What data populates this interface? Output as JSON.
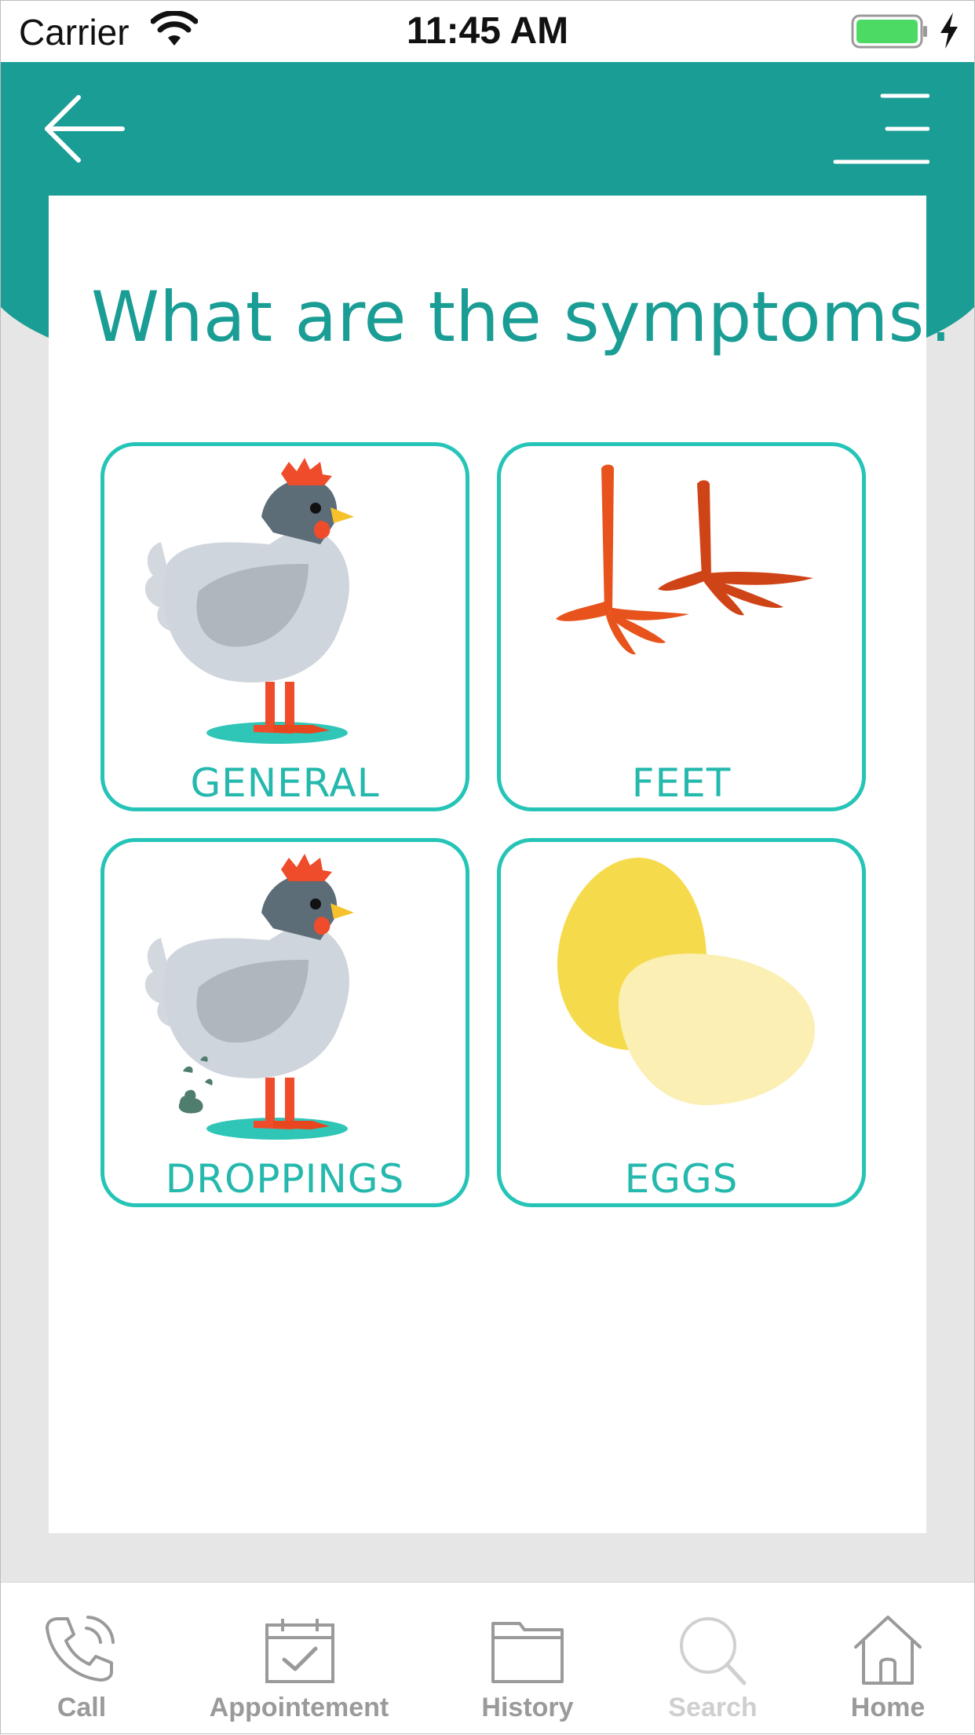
{
  "status_bar": {
    "carrier": "Carrier",
    "time": "11:45 AM"
  },
  "header": {
    "back_icon": "arrow-left-icon",
    "menu_icon": "menu-lines-icon"
  },
  "page": {
    "title": "What are the symptoms?"
  },
  "categories": [
    {
      "label": "GENERAL",
      "icon": "chicken-icon"
    },
    {
      "label": "FEET",
      "icon": "chicken-feet-icon"
    },
    {
      "label": "DROPPINGS",
      "icon": "chicken-droppings-icon"
    },
    {
      "label": "EGGS",
      "icon": "eggs-icon"
    }
  ],
  "tab_bar": {
    "items": [
      {
        "label": "Call",
        "icon": "phone-icon"
      },
      {
        "label": "Appointement",
        "icon": "calendar-check-icon"
      },
      {
        "label": "History",
        "icon": "folder-icon"
      },
      {
        "label": "Search",
        "icon": "search-icon"
      },
      {
        "label": "Home",
        "icon": "home-icon"
      }
    ]
  },
  "colors": {
    "primary": "#1a9d94",
    "tile_border": "#25c4b7",
    "background": "#e6e6e6"
  }
}
